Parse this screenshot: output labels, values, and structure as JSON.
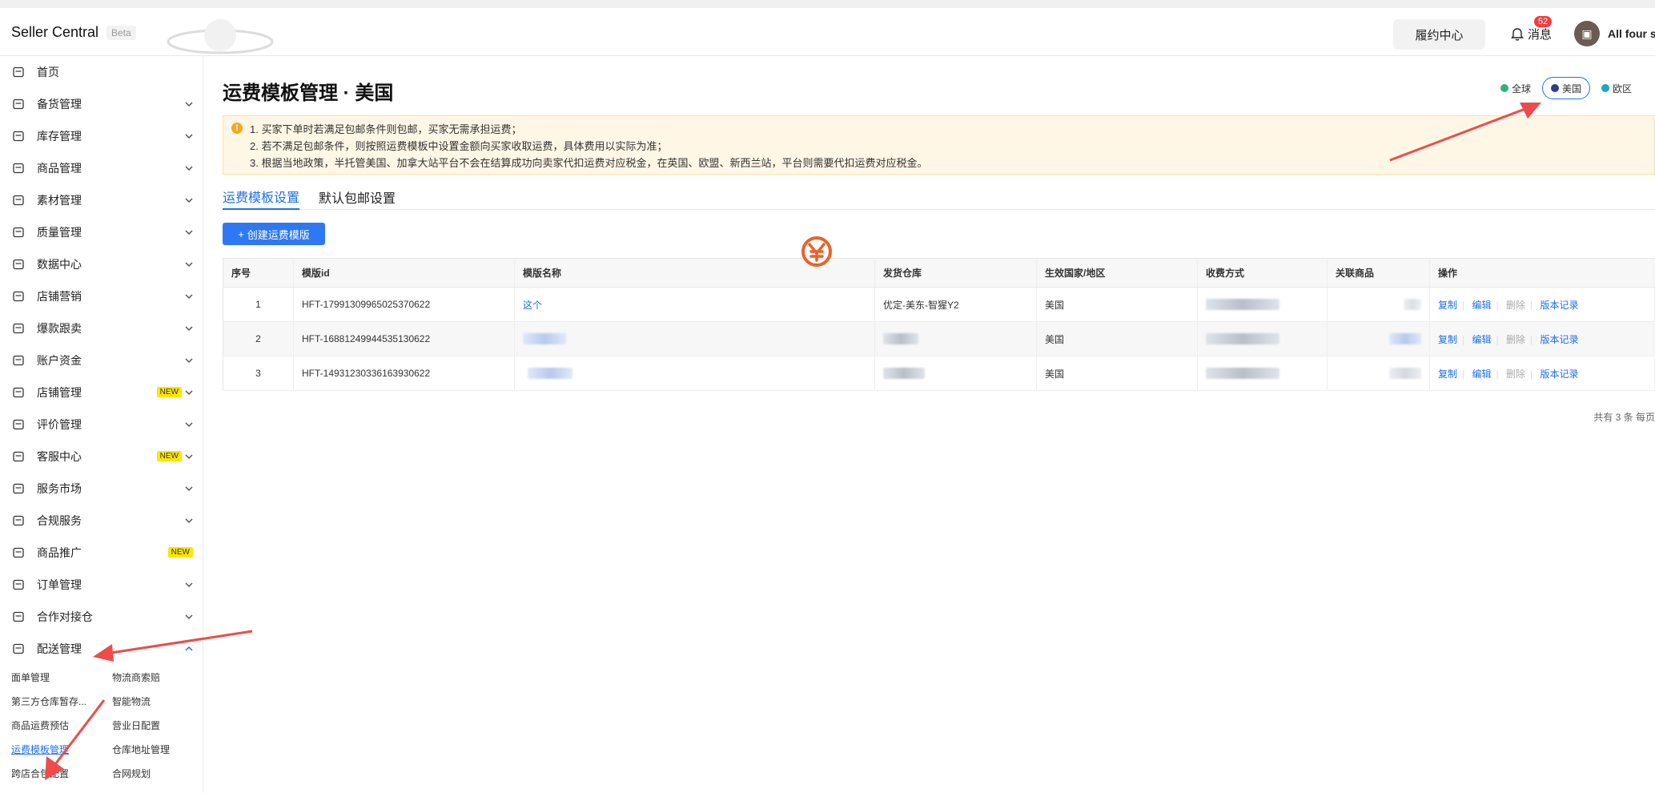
{
  "topbar": {
    "brand": "Seller Central",
    "beta": "Beta",
    "fulfillment_button": "履约中心",
    "messages_label": "消息",
    "messages_badge": "52",
    "account_name": "All four se"
  },
  "sidebar": {
    "items": [
      {
        "label": "首页",
        "icon": "home-icon",
        "chevron": false
      },
      {
        "label": "备货管理",
        "icon": "clipboard-icon",
        "chevron": true
      },
      {
        "label": "库存管理",
        "icon": "warehouse-icon",
        "chevron": true
      },
      {
        "label": "商品管理",
        "icon": "box-icon",
        "chevron": true
      },
      {
        "label": "素材管理",
        "icon": "shapes-icon",
        "chevron": true
      },
      {
        "label": "质量管理",
        "icon": "shield-check-icon",
        "chevron": true
      },
      {
        "label": "数据中心",
        "icon": "data-icon",
        "chevron": true
      },
      {
        "label": "店铺营销",
        "icon": "tag-icon",
        "chevron": true
      },
      {
        "label": "爆款跟卖",
        "icon": "cart-icon",
        "chevron": true
      },
      {
        "label": "账户资金",
        "icon": "wallet-icon",
        "chevron": true
      },
      {
        "label": "店铺管理",
        "icon": "store-icon",
        "chevron": true,
        "badge": "NEW"
      },
      {
        "label": "评价管理",
        "icon": "review-icon",
        "chevron": true
      },
      {
        "label": "客服中心",
        "icon": "chat-icon",
        "chevron": true,
        "badge": "NEW"
      },
      {
        "label": "服务市场",
        "icon": "gear-icon",
        "chevron": true
      },
      {
        "label": "合规服务",
        "icon": "document-icon",
        "chevron": true
      },
      {
        "label": "商品推广",
        "icon": "ad-icon",
        "chevron": false,
        "badge": "NEW"
      },
      {
        "label": "订单管理",
        "icon": "cart-icon",
        "chevron": true
      },
      {
        "label": "合作对接仓",
        "icon": "warehouse-icon",
        "chevron": true
      },
      {
        "label": "配送管理",
        "icon": "truck-icon",
        "chevron": "up"
      }
    ],
    "sub_items": [
      {
        "label": "面单管理",
        "active": false
      },
      {
        "label": "物流商索赔",
        "active": false
      },
      {
        "label": "第三方仓库暂存...",
        "active": false
      },
      {
        "label": "智能物流",
        "active": false
      },
      {
        "label": "商品运费预估",
        "active": false
      },
      {
        "label": "营业日配置",
        "active": false
      },
      {
        "label": "运费模板管理",
        "active": true
      },
      {
        "label": "仓库地址管理",
        "active": false
      },
      {
        "label": "跨店合包配置",
        "active": false
      },
      {
        "label": "合网规划",
        "active": false
      }
    ]
  },
  "main": {
    "title": "运费模板管理 · 美国",
    "regions": [
      {
        "label": "全球",
        "color": "#2fb37a",
        "active": false
      },
      {
        "label": "美国",
        "color": "#2a3d8f",
        "active": true
      },
      {
        "label": "欧区",
        "color": "#1aa7c0",
        "active": false
      }
    ],
    "notices": [
      "1. 买家下单时若满足包邮条件则包邮，买家无需承担运费；",
      "2. 若不满足包邮条件，则按照运费模板中设置金额向买家收取运费，具体费用以实际为准；",
      "3. 根据当地政策，半托管美国、加拿大站平台不会在结算成功向卖家代扣运费对应税金，在英国、欧盟、新西兰站，平台则需要代扣运费对应税金。"
    ],
    "tabs": [
      "运费模板设置",
      "默认包邮设置"
    ],
    "create_button": "创建运费模版",
    "table": {
      "headers": [
        "序号",
        "模版id",
        "模版名称",
        "发货仓库",
        "生效国家/地区",
        "收费方式",
        "关联商品",
        "操作"
      ],
      "rows": [
        {
          "index": "1",
          "id": "HFT-17991309965025370622",
          "name": "这个",
          "warehouse": "优定-美东-智猩Y2",
          "country": "美国"
        },
        {
          "index": "2",
          "id": "HFT-16881249944535130622",
          "name": "",
          "warehouse": "",
          "country": "美国"
        },
        {
          "index": "3",
          "id": "HFT-14931230336163930622",
          "name": "",
          "warehouse": "",
          "country": "美国"
        }
      ],
      "actions": {
        "copy": "复制",
        "edit": "编辑",
        "delete": "删除",
        "history": "版本记录"
      }
    },
    "pager": "共有 3 条  每页"
  }
}
